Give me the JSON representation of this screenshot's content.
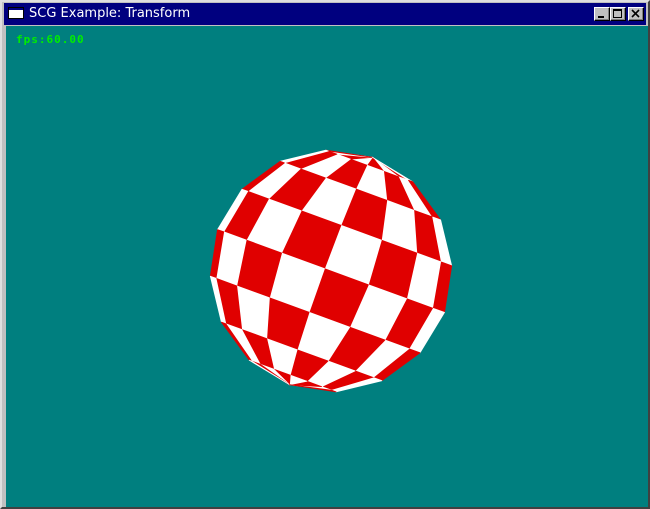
{
  "window": {
    "title": "SCG Example: Transform",
    "controls": {
      "minimize": "minimize-icon",
      "maximize": "maximize-icon",
      "close": "close-icon"
    }
  },
  "viewport": {
    "background": "#007f7f",
    "fps_text": "fps:60.00",
    "fps_color": "#00ee00",
    "ball": {
      "colors": [
        "#e00000",
        "#ffffff"
      ]
    }
  }
}
